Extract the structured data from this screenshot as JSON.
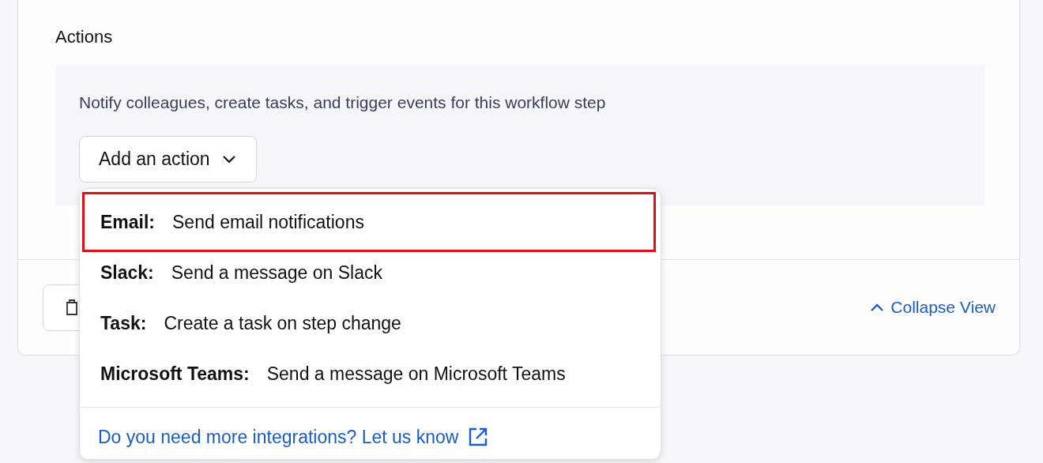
{
  "section": {
    "title": "Actions",
    "description": "Notify colleagues, create tasks, and trigger events for this workflow step",
    "add_button": {
      "label": "Add an action",
      "expanded": true
    }
  },
  "menu": {
    "items": [
      {
        "label": "Email:",
        "description": "Send email notifications",
        "highlighted": true
      },
      {
        "label": "Slack:",
        "description": "Send a message on Slack",
        "highlighted": false
      },
      {
        "label": "Task:",
        "description": "Create a task on step change",
        "highlighted": false
      },
      {
        "label": "Microsoft Teams:",
        "description": "Send a message on Microsoft Teams",
        "highlighted": false
      }
    ],
    "footer_link": "Do you need more integrations? Let us know"
  },
  "footer": {
    "collapse_link": "Collapse View"
  }
}
